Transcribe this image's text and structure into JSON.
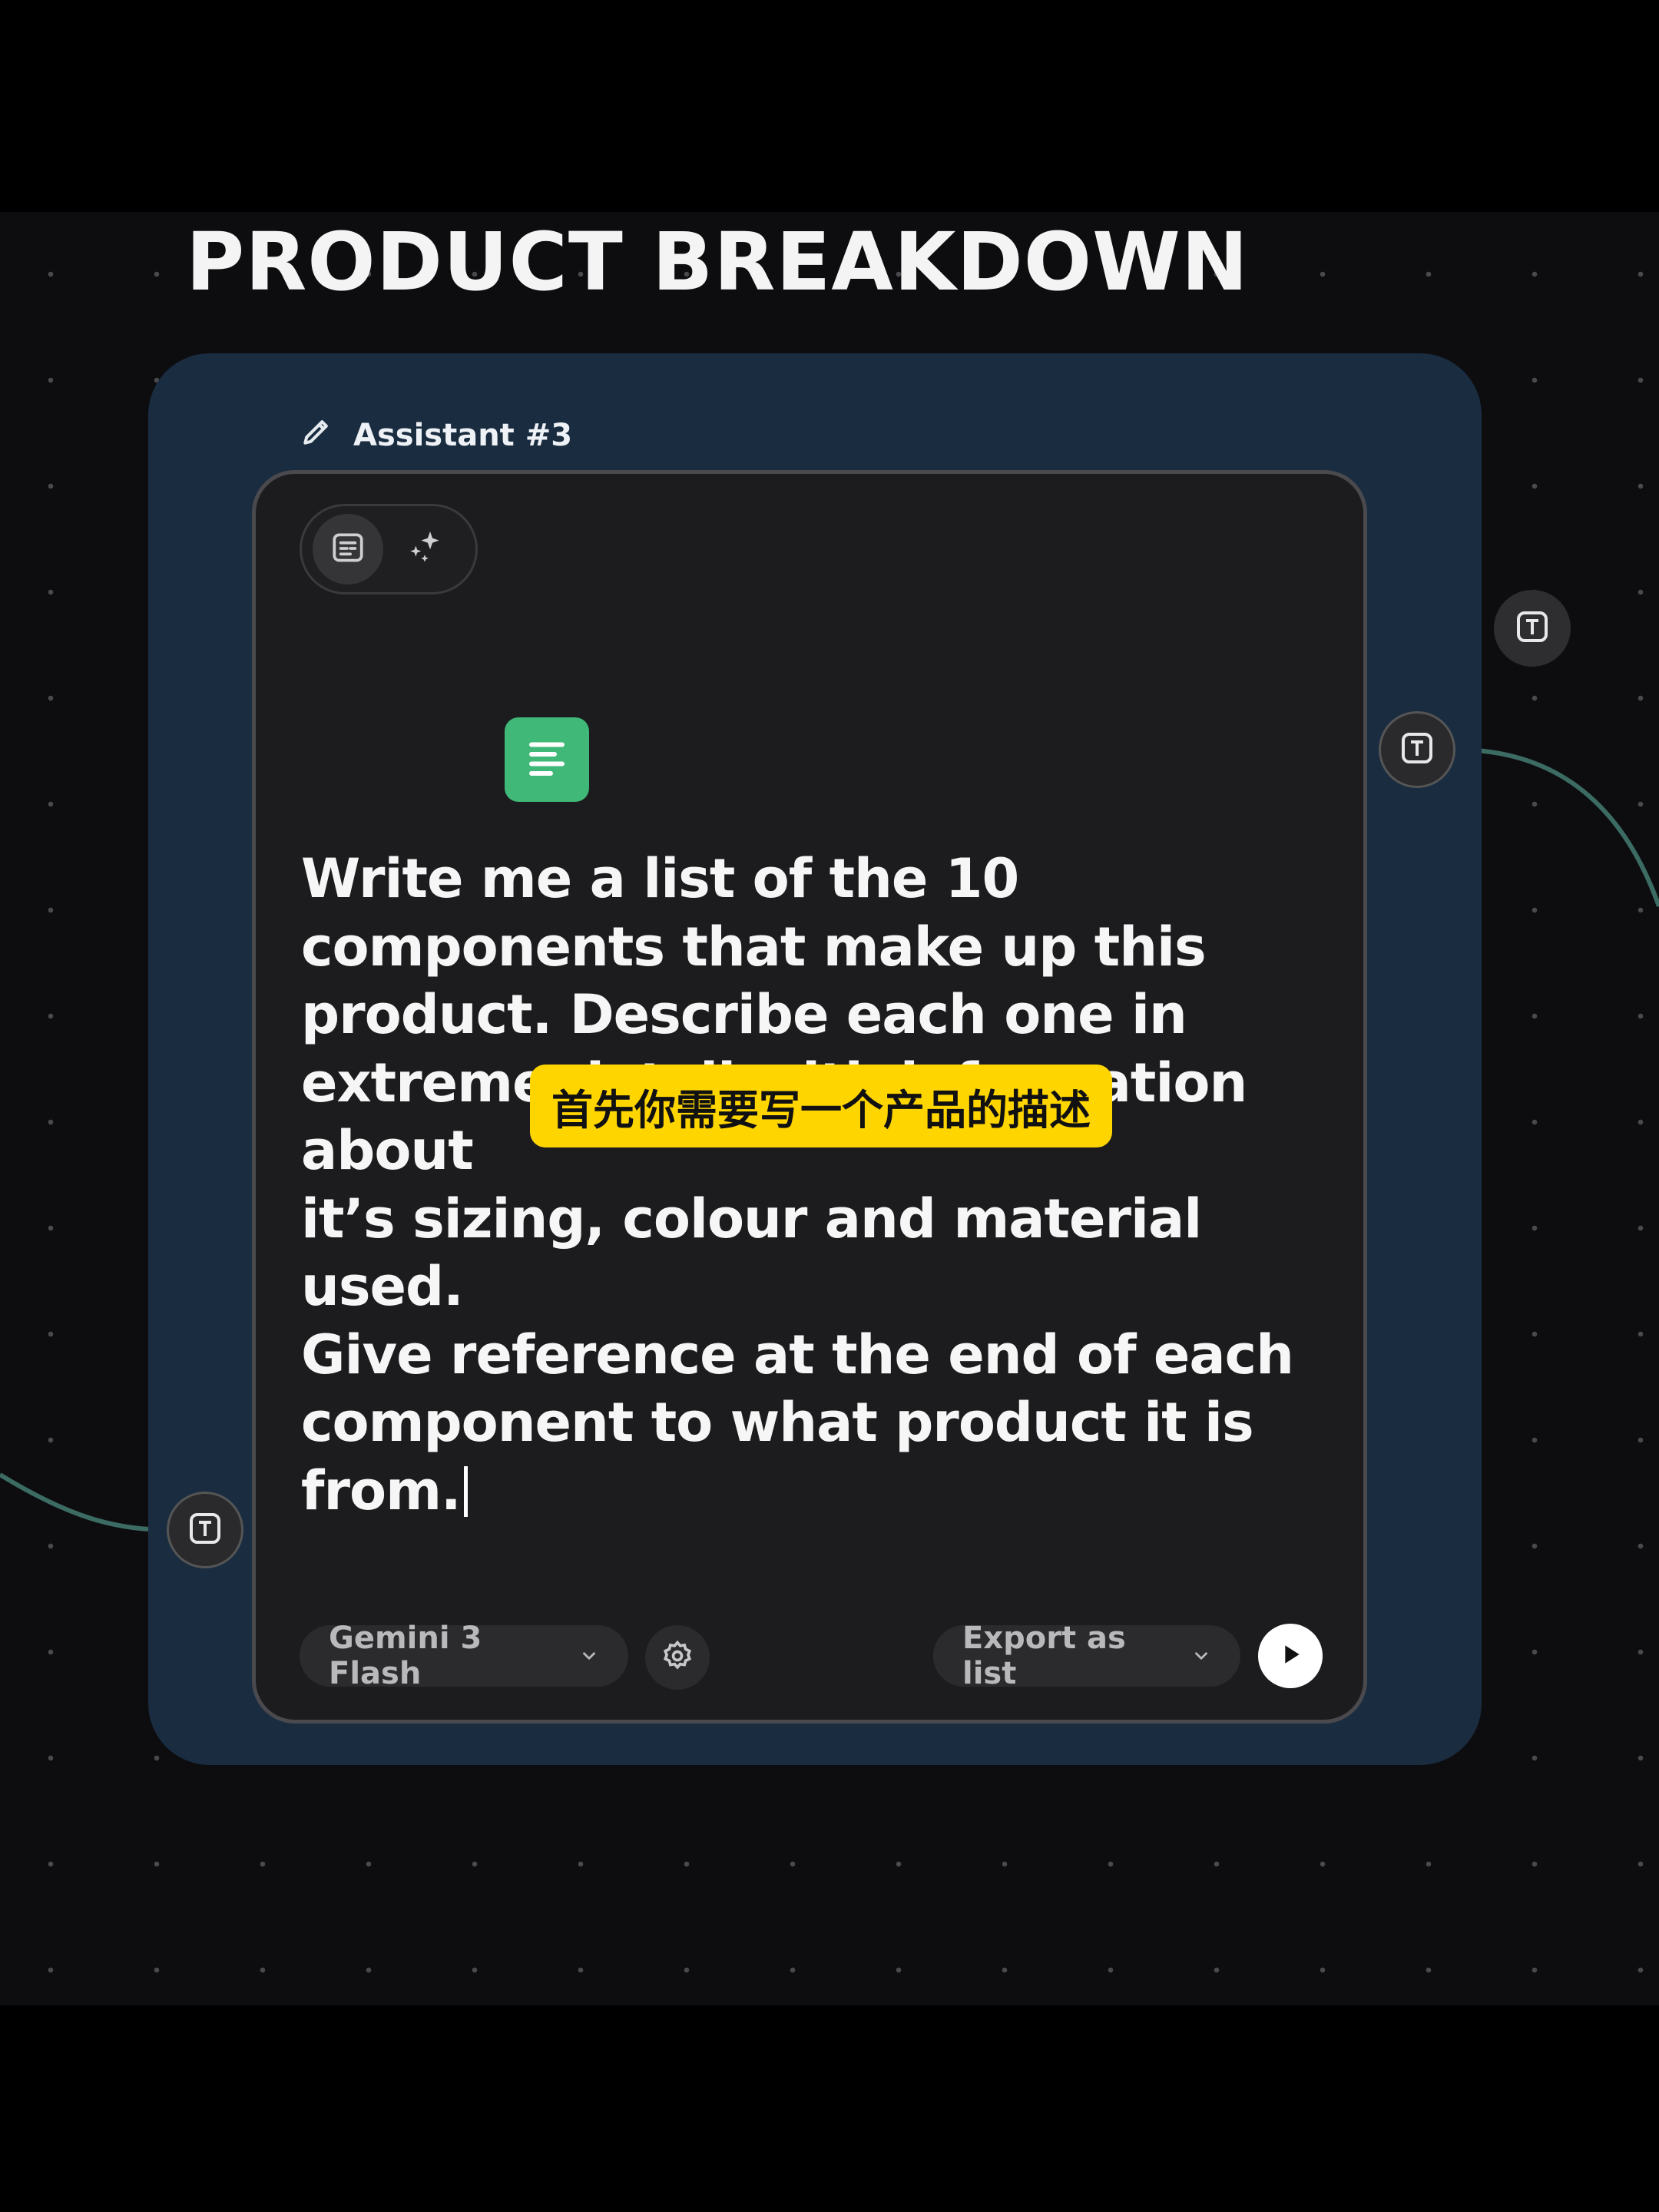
{
  "canvas": {
    "title": "PRODUCT BREAKDOWN"
  },
  "node": {
    "label": "Assistant #3",
    "prompt_text": "Write me a list of the 10\ncomponents that make up this\nproduct. Describe each one in\nextreme detail with information about\nit’s sizing, colour and material used.\nGive reference at the end of each\ncomponent to what product it is\nfrom.",
    "model_select": "Gemini 3 Flash",
    "export_select": "Export as list"
  },
  "subtitle_overlay": "首先你需要写一个产品的描述",
  "icons": {
    "edit": "pencil-icon",
    "doc": "document-icon",
    "sparkle": "sparkle-icon",
    "format": "align-left-icon",
    "settings": "gear-icon",
    "run": "play-icon",
    "port": "text-port-icon",
    "chevron": "chevron-down-icon"
  },
  "colors": {
    "group_bg": "#1a2c40",
    "card_bg": "#1c1c1e",
    "accent_green": "#3fb878",
    "subtitle_bg": "#ffd500",
    "wire": "#3b6b62"
  }
}
